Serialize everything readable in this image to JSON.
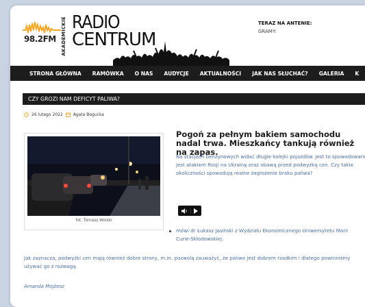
{
  "brand": {
    "frequency": "98.2FM",
    "academic": "AKADEMICKIE",
    "name_top": "RADIO",
    "name_bottom": "CENTRUM"
  },
  "onair": {
    "label": "TERAZ NA ANTENIE:",
    "playing_label": "GRAMY:"
  },
  "nav": {
    "items": [
      "STRONA GŁÓWNA",
      "RAMÓWKA",
      "O NAS",
      "AUDYCJE",
      "AKTUALNOŚCI",
      "JAK NAS SŁUCHAĆ?",
      "GALERIA",
      "K"
    ]
  },
  "article": {
    "section_title": "CZY GROZI NAM DEFICYT PALIWA?",
    "date": "26 lutego 2022",
    "author_meta": "Agata Bogucka",
    "photo_caption": "fot. Tomasz Wolski",
    "headline": "Pogoń za pełnym bakiem samochodu nadal trwa. Mieszkańcy tankują również na zapas.",
    "lead": "Na stacjach benzynowych widać długie kolejki pojazdów. Jest to spowodowane jest atakiem Rosji na Ukrainę oraz obawą przed podwyżką cen. Czy takie okoliczności spowodują realne zagrożenie braku paliwa?",
    "bullet": "mówi dr Łukasz Jasiński z Wydziału Ekonomicznego Uniwersytetu Marii Curie-Skłodowskiej.",
    "paragraph": "Jak zaznacza, podwyżki cen mają również dobre strony, m.in. pozwolą zauważyć, że paliwo jest dobrem rzadkim i dlatego powinniśmy używać go z rozwagą.",
    "signature": "Amanda Mojżesz"
  },
  "colors": {
    "accent": "#f5a623",
    "nav_bg": "#1d1d1d",
    "link_text": "#4a6ea8"
  }
}
